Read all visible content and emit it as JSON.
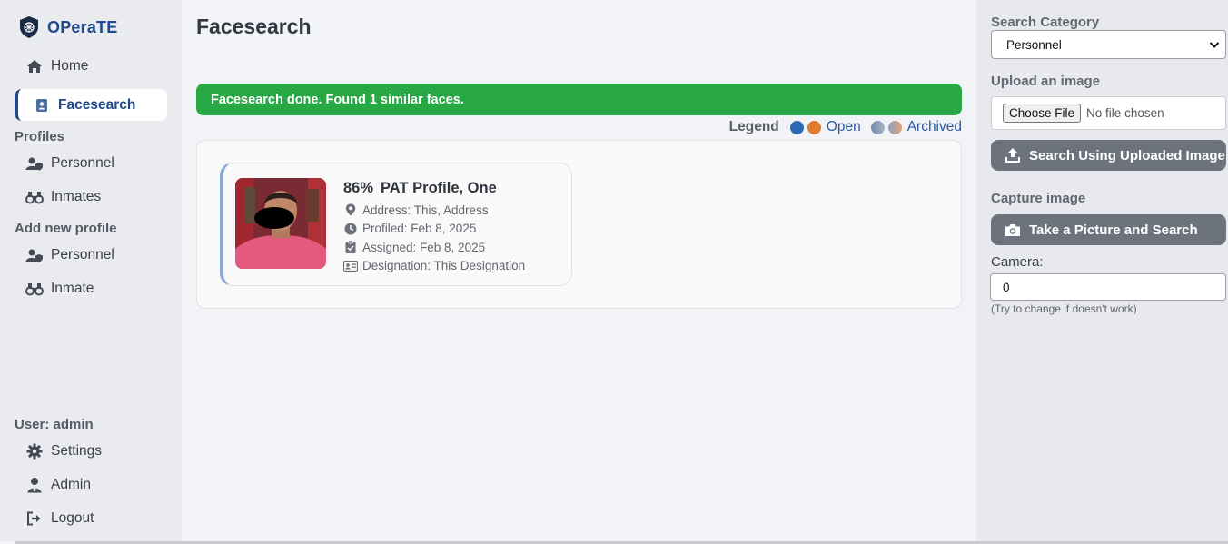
{
  "app": {
    "name": "OPeraTE"
  },
  "sidebar": {
    "home": "Home",
    "facesearch": "Facesearch",
    "profiles_title": "Profiles",
    "profiles_personnel": "Personnel",
    "profiles_inmates": "Inmates",
    "add_title": "Add new profile",
    "add_personnel": "Personnel",
    "add_inmate": "Inmate",
    "user_label": "User: admin",
    "settings": "Settings",
    "admin": "Admin",
    "logout": "Logout"
  },
  "main": {
    "title": "Facesearch",
    "alert": "Facesearch done. Found 1 similar faces.",
    "legend": {
      "label": "Legend",
      "open": "Open",
      "archived": "Archived"
    }
  },
  "result": {
    "percent": "86%",
    "name": "PAT Profile, One",
    "address": "Address: This, Address",
    "profiled": "Profiled: Feb 8, 2025",
    "assigned": "Assigned: Feb 8, 2025",
    "designation": "Designation: This Designation"
  },
  "right_panel": {
    "category_label": "Search Category",
    "category_value": "Personnel",
    "upload_label": "Upload an image",
    "choose_file": "Choose File",
    "no_file": "No file chosen",
    "search_uploaded": "Search Using Uploaded Image",
    "capture_label": "Capture image",
    "take_picture": "Take a Picture and Search",
    "camera_label": "Camera:",
    "camera_value": "0",
    "camera_hint": "(Try to change if doesn't work)"
  },
  "colors": {
    "brand": "#214a8a",
    "success": "#28a745",
    "button": "#6c737c",
    "open_blue": "#2c6ab4",
    "open_orange": "#e07a2e"
  }
}
